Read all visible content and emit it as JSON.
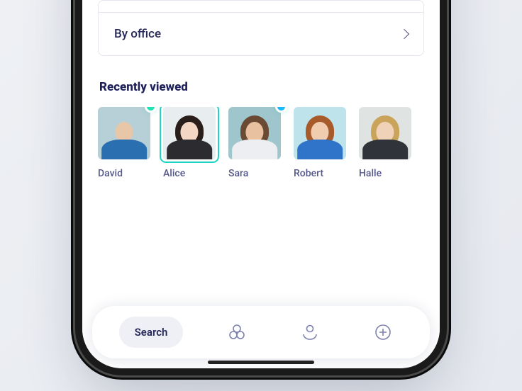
{
  "filters": {
    "by_office": "By office"
  },
  "recently_viewed": {
    "title": "Recently viewed",
    "people": [
      {
        "name": "David",
        "selected": false,
        "status": "online",
        "status_color": "#1fe3b3",
        "bg": "#b7cfd6",
        "skin": "#e8c7a8",
        "shirt": "#2a6fb0"
      },
      {
        "name": "Alice",
        "selected": true,
        "status": null,
        "bg": "#e8eef0",
        "skin": "#f3d7c4",
        "shirt": "#2b2b30",
        "hair": "#2a1e1a"
      },
      {
        "name": "Sara",
        "selected": false,
        "status": "online",
        "status_color": "#19b8ff",
        "bg": "#9fc6cc",
        "skin": "#e8c2a0",
        "shirt": "#eceef2",
        "hair": "#6a4a32"
      },
      {
        "name": "Robert",
        "selected": false,
        "status": null,
        "bg": "#bfe3eb",
        "skin": "#f1cdb0",
        "shirt": "#2f74c9",
        "hair": "#a85b2a"
      },
      {
        "name": "Halle",
        "selected": false,
        "status": null,
        "bg": "#dfe4e2",
        "skin": "#f0d2b8",
        "shirt": "#30343a",
        "hair": "#c9a45a"
      }
    ]
  },
  "tabbar": {
    "search_label": "Search"
  },
  "colors": {
    "primary_text": "#26285a",
    "accent": "#1fd4c4"
  }
}
